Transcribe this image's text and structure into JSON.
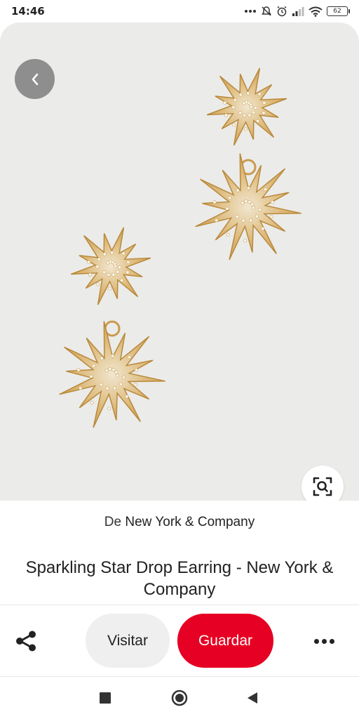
{
  "status_bar": {
    "time": "14:46",
    "battery": "62",
    "icons": [
      "more-dots-icon",
      "notifications-off-icon",
      "alarm-icon",
      "signal-icon",
      "wifi-icon",
      "battery-icon"
    ]
  },
  "pin": {
    "source_prefix": "De",
    "source_name": "New York & Company",
    "title": "Sparkling Star Drop Earring - New York & Company"
  },
  "actions": {
    "visit_label": "Visitar",
    "save_label": "Guardar"
  },
  "colors": {
    "save_red": "#e60023",
    "image_bg": "#ebebe9",
    "gold": "#d4aa62"
  }
}
